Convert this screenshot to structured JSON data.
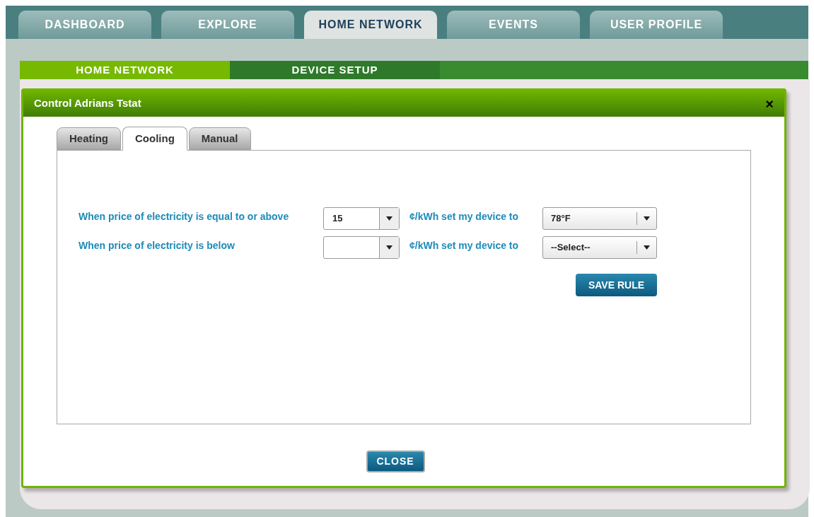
{
  "nav_tabs": [
    {
      "label": "DASHBOARD",
      "selected": false
    },
    {
      "label": "EXPLORE",
      "selected": false
    },
    {
      "label": "HOME NETWORK",
      "selected": true
    },
    {
      "label": "EVENTS",
      "selected": false
    },
    {
      "label": "USER PROFILE",
      "selected": false
    }
  ],
  "sub_tabs": [
    {
      "label": "HOME NETWORK",
      "selected": true
    },
    {
      "label": "DEVICE SETUP",
      "selected": false
    }
  ],
  "dialog": {
    "title": "Control Adrians Tstat",
    "close": "×",
    "tabs": [
      {
        "label": "Heating",
        "selected": false
      },
      {
        "label": "Cooling",
        "selected": true
      },
      {
        "label": "Manual",
        "selected": false
      }
    ],
    "rules": [
      {
        "condition": "When price of electricity is equal to or above",
        "price": "15",
        "unit_label": "¢/kWh set my device to",
        "setpoint": "78°F"
      },
      {
        "condition": "When price of electricity is below",
        "unit_label": "¢/kWh set my device to",
        "setpoint": "--Select--"
      }
    ],
    "save_button": "SAVE RULE",
    "close_button": "CLOSE"
  }
}
